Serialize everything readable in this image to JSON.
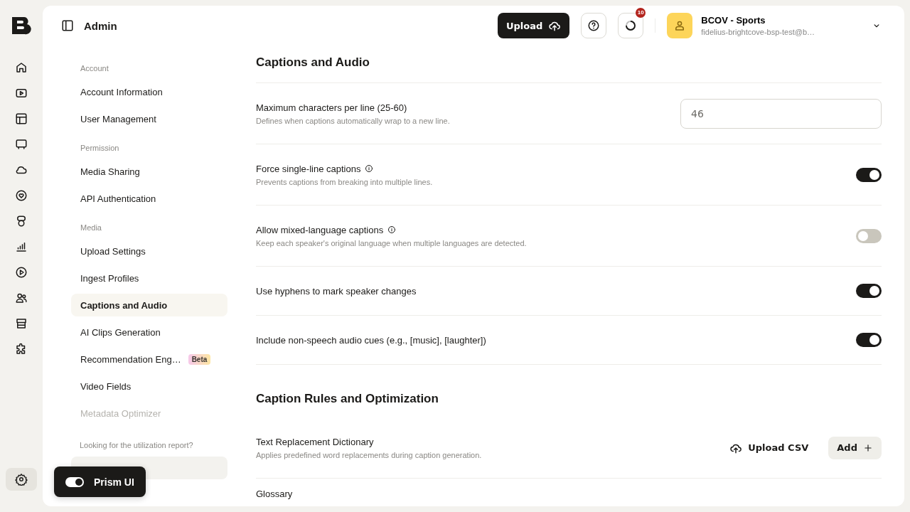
{
  "rail_items": [
    {
      "selected": false
    },
    {
      "selected": false
    },
    {
      "selected": false
    },
    {
      "selected": false
    },
    {
      "selected": false
    },
    {
      "selected": false
    },
    {
      "selected": false
    },
    {
      "selected": false
    },
    {
      "selected": false
    },
    {
      "selected": false
    },
    {
      "selected": false
    },
    {
      "selected": false
    },
    {
      "selected": true
    }
  ],
  "header": {
    "title": "Admin",
    "upload_button": "Upload",
    "notification_count": "10",
    "account": {
      "name": "BCOV - Sports",
      "email": "fidelius-brightcove-bsp-test@b…"
    }
  },
  "sidebar": {
    "groups": [
      {
        "heading": "Account",
        "items": [
          {
            "label": "Account Information",
            "selected": false,
            "disabled": false
          },
          {
            "label": "User Management",
            "selected": false,
            "disabled": false
          }
        ]
      },
      {
        "heading": "Permission",
        "items": [
          {
            "label": "Media Sharing",
            "selected": false,
            "disabled": false
          },
          {
            "label": "API Authentication",
            "selected": false,
            "disabled": false
          }
        ]
      },
      {
        "heading": "Media",
        "items": [
          {
            "label": "Upload Settings",
            "selected": false,
            "disabled": false
          },
          {
            "label": "Ingest Profiles",
            "selected": false,
            "disabled": false
          },
          {
            "label": "Captions and Audio",
            "selected": true,
            "disabled": false
          },
          {
            "label": "AI Clips Generation",
            "selected": false,
            "disabled": false
          },
          {
            "label": "Recommendation Eng…",
            "badge": "Beta",
            "selected": false,
            "disabled": false
          },
          {
            "label": "Video Fields",
            "selected": false,
            "disabled": false
          },
          {
            "label": "Metadata Optimizer",
            "selected": false,
            "disabled": true
          }
        ]
      }
    ],
    "footer_note": "Looking for the utilization report?"
  },
  "toast": {
    "label": "Prism UI",
    "on": true
  },
  "sections": [
    {
      "title": "Captions and Audio",
      "rows": [
        {
          "kind": "number",
          "label": "Maximum characters per line (25-60)",
          "description": "Defines when captions automatically wrap to a new line.",
          "value": "46"
        },
        {
          "kind": "toggle",
          "label": "Force single-line captions",
          "info": true,
          "description": "Prevents captions from breaking into multiple lines.",
          "on": true
        },
        {
          "kind": "toggle",
          "label": "Allow mixed-language captions",
          "info": true,
          "description": "Keep each speaker's original language when multiple languages are detected.",
          "on": false
        },
        {
          "kind": "toggle",
          "label": "Use hyphens to mark speaker changes",
          "info": false,
          "on": true
        },
        {
          "kind": "toggle",
          "label": "Include non-speech audio cues (e.g., [music], [laughter])",
          "info": false,
          "on": true
        }
      ]
    },
    {
      "title": "Caption Rules and Optimization",
      "rows": [
        {
          "kind": "actions",
          "label": "Text Replacement Dictionary",
          "description": "Applies predefined word replacements during caption generation.",
          "upload": "Upload CSV",
          "add": "Add"
        },
        {
          "kind": "actions",
          "label": "Glossary"
        }
      ]
    }
  ]
}
